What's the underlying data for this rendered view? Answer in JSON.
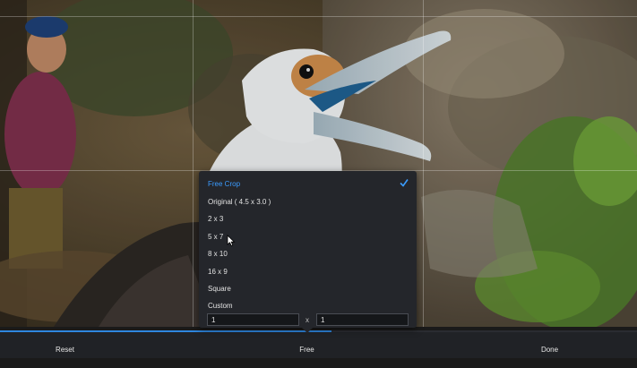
{
  "photo": {
    "description_icon": "frigatebird-chick-photo"
  },
  "crop_menu": {
    "items": [
      {
        "label": "Free Crop",
        "selected": true
      },
      {
        "label": "Original  ( 4.5 x 3.0 )",
        "selected": false
      },
      {
        "label": "2 x 3",
        "selected": false
      },
      {
        "label": "5 x 7",
        "selected": false
      },
      {
        "label": "8 x 10",
        "selected": false
      },
      {
        "label": "16 x 9",
        "selected": false
      },
      {
        "label": "Square",
        "selected": false
      },
      {
        "label": "Custom",
        "selected": false
      }
    ],
    "custom": {
      "width_value": "1",
      "height_value": "1",
      "separator": "x"
    },
    "check_icon": "checkmark-icon"
  },
  "bottom_bar": {
    "reset_label": "Reset",
    "free_label": "Free",
    "done_label": "Done"
  },
  "progress": {
    "fraction": 0.52
  },
  "colors": {
    "accent": "#3b9cff",
    "menu_bg": "#24262b",
    "bar_bg": "#202226"
  }
}
